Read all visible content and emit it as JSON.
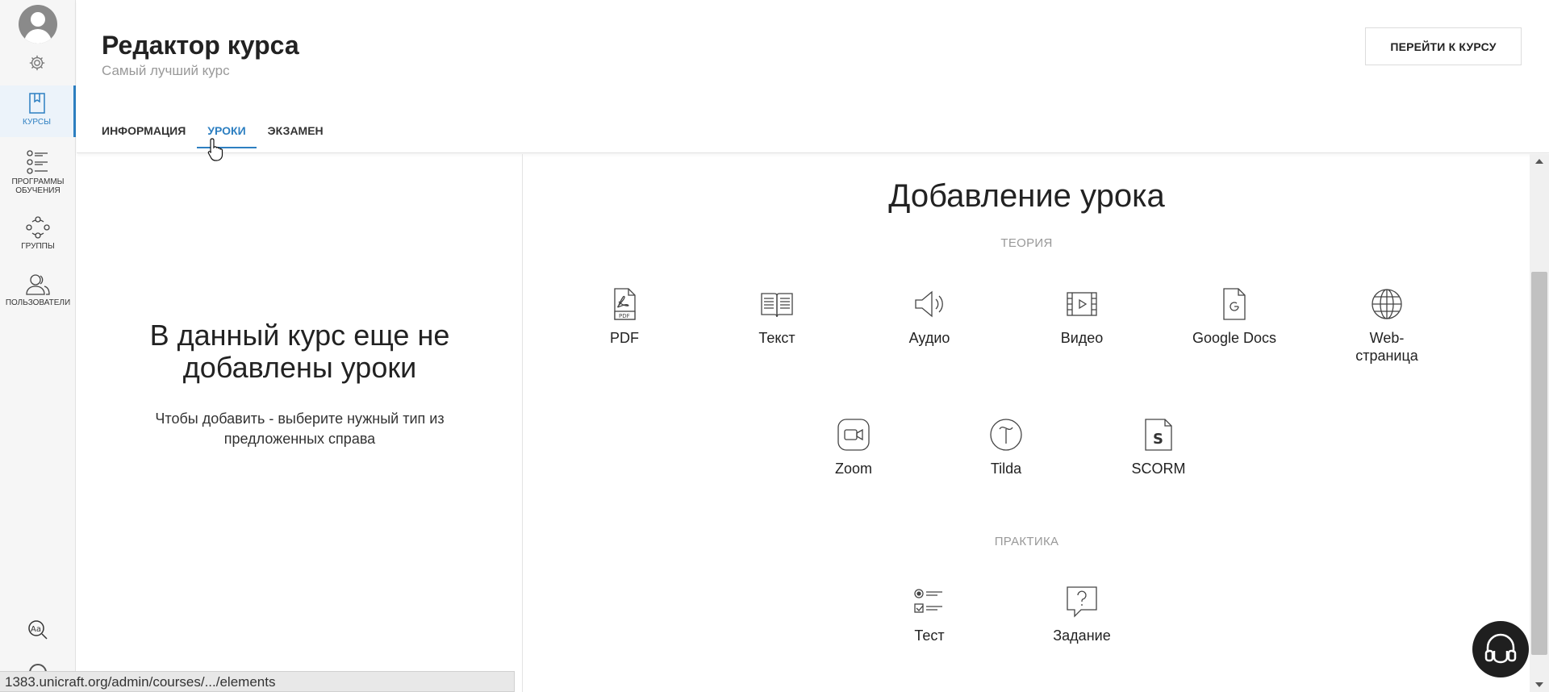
{
  "sidebar": {
    "items": [
      {
        "label": "КУРСЫ"
      },
      {
        "label": "ПРОГРАММЫ ОБУЧЕНИЯ"
      },
      {
        "label": "ГРУППЫ"
      },
      {
        "label": "ПОЛЬЗОВАТЕЛИ"
      }
    ]
  },
  "header": {
    "title": "Редактор курса",
    "subtitle": "Самый лучший курс",
    "go_button": "ПЕРЕЙТИ К КУРСУ",
    "tabs": [
      {
        "label": "ИНФОРМАЦИЯ"
      },
      {
        "label": "УРОКИ"
      },
      {
        "label": "ЭКЗАМЕН"
      }
    ]
  },
  "empty": {
    "title_line1": "В данный курс еще не",
    "title_line2": "добавлены уроки",
    "hint_line1": "Чтобы добавить - выберите нужный тип из",
    "hint_line2": "предложенных справа"
  },
  "add_lesson": {
    "title": "Добавление урока",
    "theory_label": "ТЕОРИЯ",
    "practice_label": "ПРАКТИКА",
    "theory": [
      {
        "label": "PDF",
        "icon": "pdf-icon"
      },
      {
        "label": "Текст",
        "icon": "book-icon"
      },
      {
        "label": "Аудио",
        "icon": "speaker-icon"
      },
      {
        "label": "Видео",
        "icon": "film-icon"
      },
      {
        "label": "Google Docs",
        "icon": "google-docs-icon"
      },
      {
        "label": "Web-страница",
        "label_line1": "Web-",
        "label_line2": "страница",
        "icon": "globe-icon"
      },
      {
        "label": "Zoom",
        "icon": "zoom-icon"
      },
      {
        "label": "Tilda",
        "icon": "tilda-icon"
      },
      {
        "label": "SCORM",
        "icon": "scorm-icon"
      }
    ],
    "practice": [
      {
        "label": "Тест",
        "icon": "checklist-icon"
      },
      {
        "label": "Задание",
        "icon": "question-bubble-icon"
      }
    ]
  },
  "statusbar": {
    "url": "1383.unicraft.org/admin/courses/.../elements"
  },
  "colors": {
    "accent": "#2d7fc1",
    "muted": "#999999",
    "sidebar_bg": "#f6f6f6"
  }
}
